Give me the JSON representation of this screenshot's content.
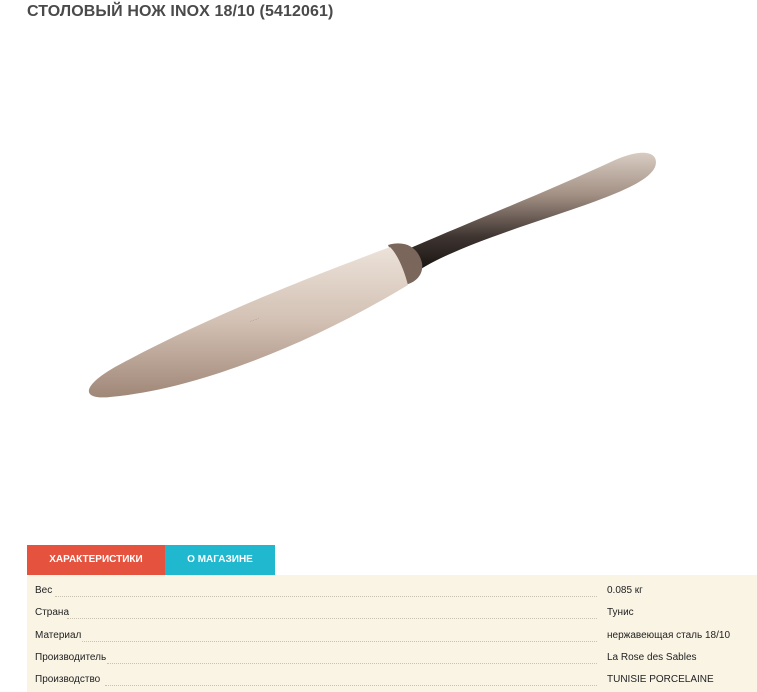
{
  "product": {
    "title": "СТОЛОВЫЙ НОЖ INOX 18/10 (5412061)",
    "image_alt_icon": "table-knife-image"
  },
  "tabs": [
    {
      "label": "ХАРАКТЕРИСТИКИ",
      "active": true,
      "color": "#e5533f"
    },
    {
      "label": "О МАГАЗИНЕ",
      "active": false,
      "color": "#1fb8cf"
    }
  ],
  "specs": [
    {
      "label": "Вес",
      "value": "0.085 кг"
    },
    {
      "label": "Страна",
      "value": "Тунис"
    },
    {
      "label": "Материал",
      "value": "нержавеющая сталь 18/10"
    },
    {
      "label": "Производитель",
      "value": "La Rose des Sables"
    },
    {
      "label": "Производство",
      "value": "TUNISIE PORCELAINE"
    }
  ],
  "colors": {
    "spec_background": "#faf4e5",
    "title_text": "#4a4a4a"
  }
}
